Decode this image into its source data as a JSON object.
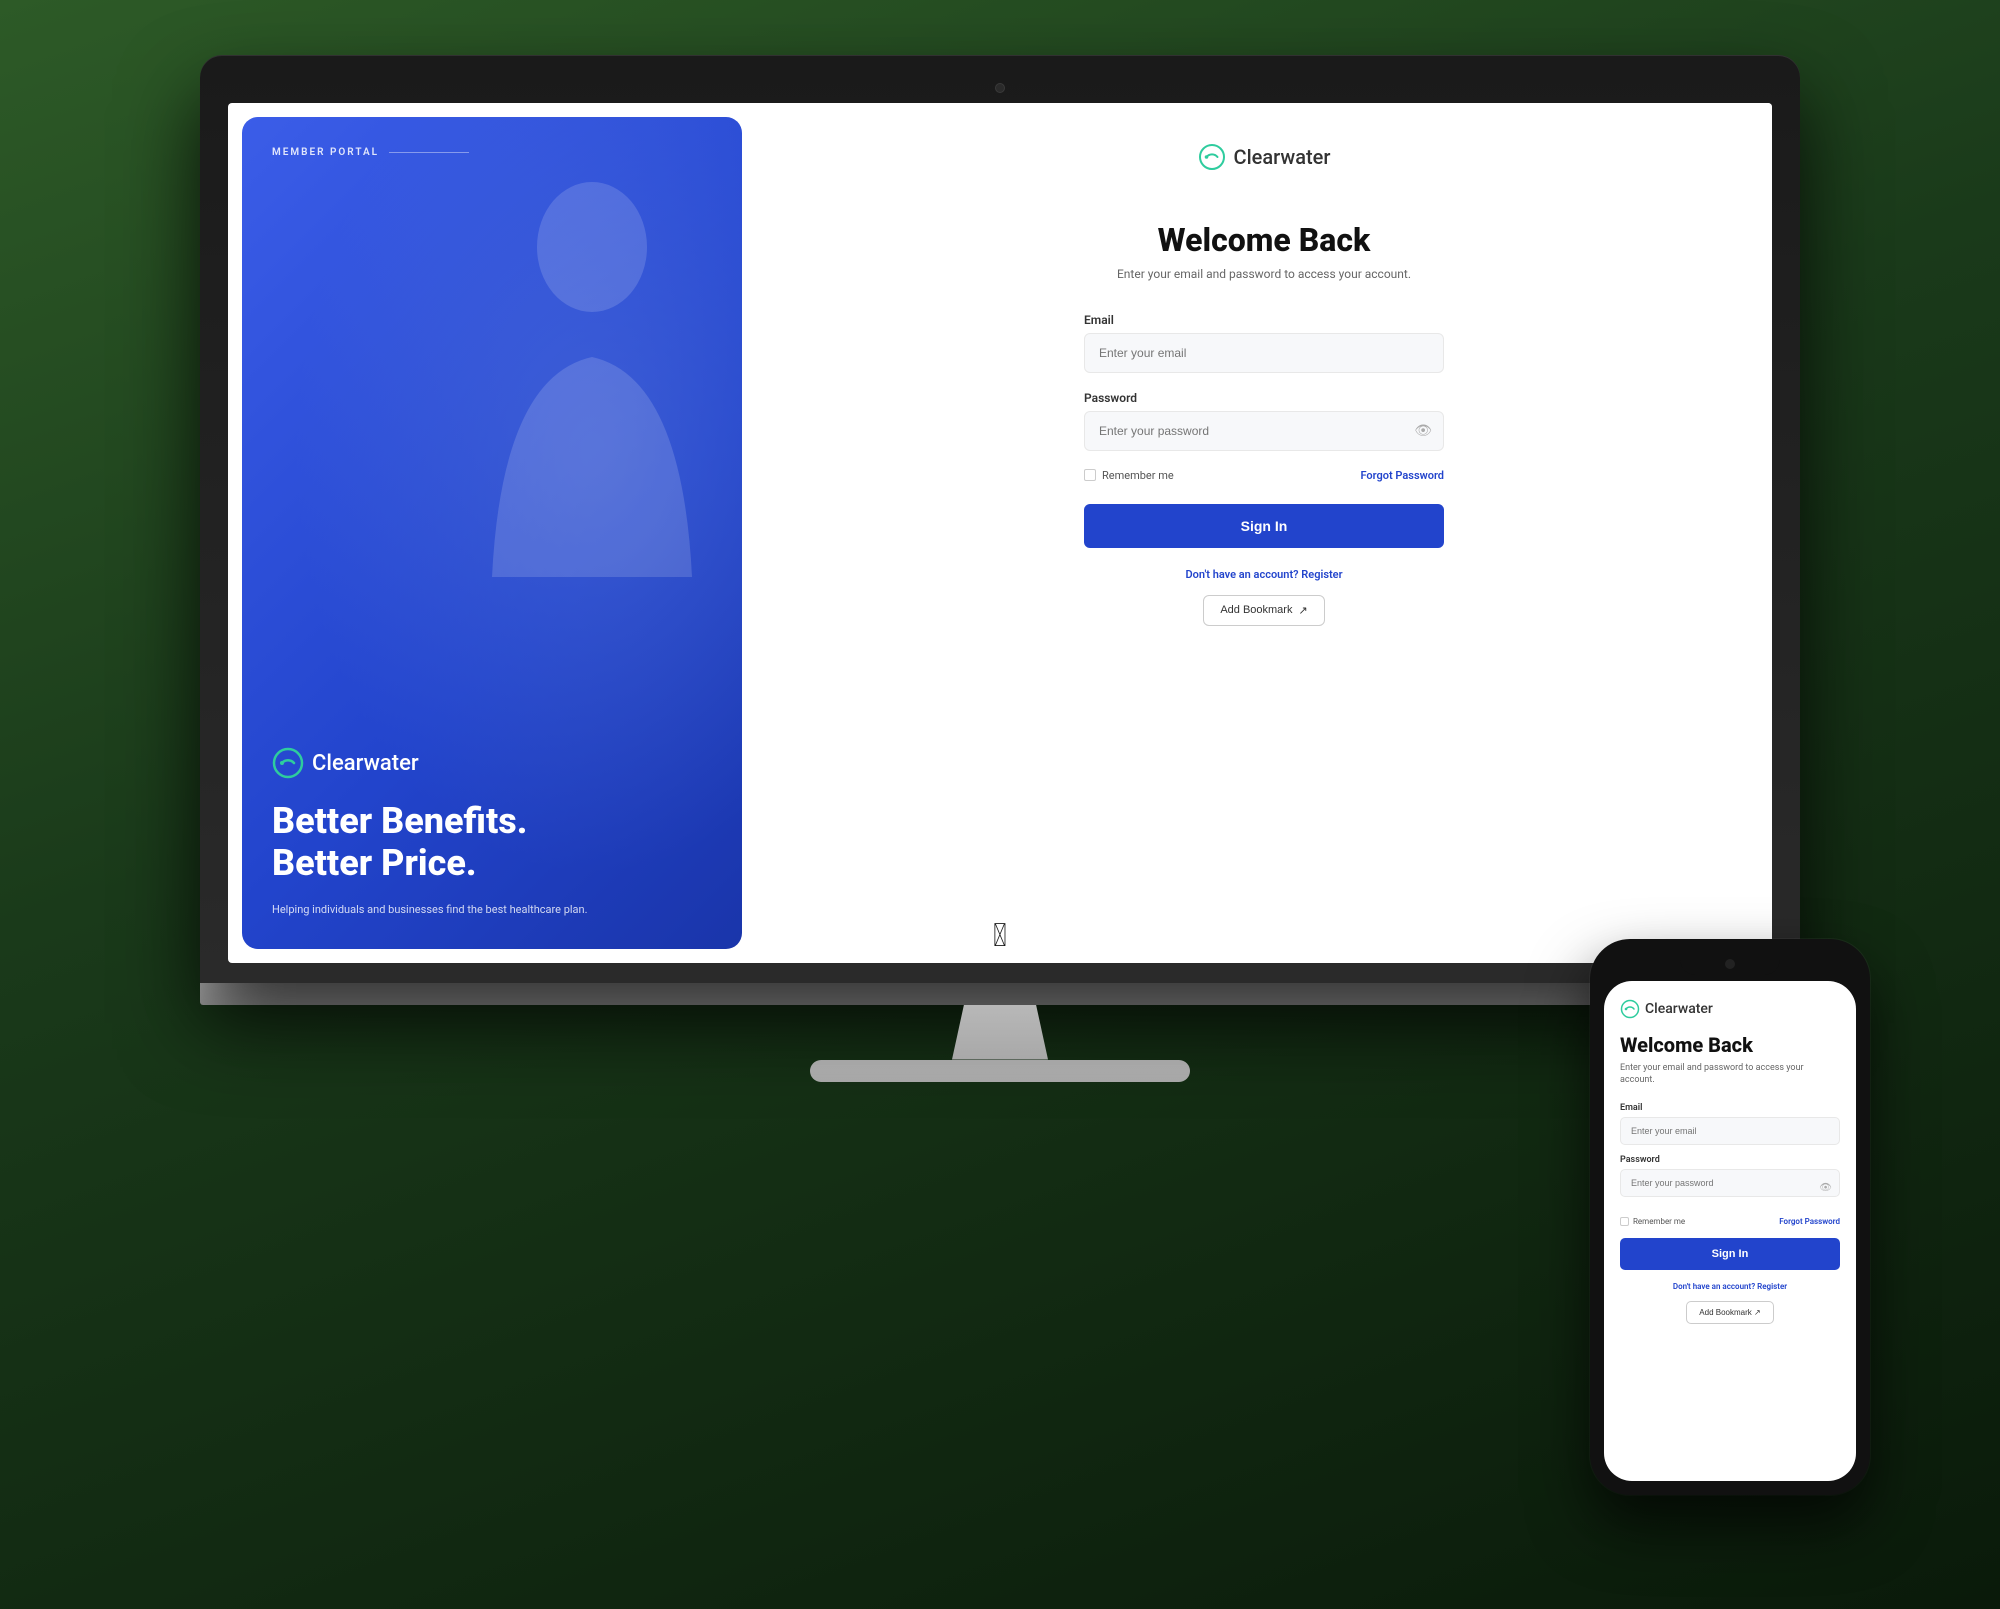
{
  "brand": {
    "name": "Clearwater",
    "color_primary": "#2ecc9e",
    "color_blue": "#2244cc"
  },
  "left_panel": {
    "member_portal_label": "MEMBER PORTAL",
    "tagline_line1": "Better Benefits.",
    "tagline_line2": "Better Price.",
    "description": "Helping individuals and businesses find the best healthcare plan."
  },
  "login_form": {
    "welcome_title": "Welcome Back",
    "welcome_subtitle": "Enter your email and password to access your account.",
    "email_label": "Email",
    "email_placeholder": "Enter your email",
    "password_label": "Password",
    "password_placeholder": "Enter your password",
    "remember_me_label": "Remember me",
    "forgot_password_label": "Forgot Password",
    "sign_in_label": "Sign In",
    "no_account_text": "Don't have an account?",
    "register_label": "Register",
    "add_bookmark_label": "Add Bookmark"
  },
  "mobile": {
    "welcome_title": "Welcome Back",
    "welcome_subtitle": "Enter your email and password to access your account.",
    "email_label": "Email",
    "email_placeholder": "Enter your email",
    "password_label": "Password",
    "password_placeholder": "Enter your password",
    "remember_me_label": "Remember me",
    "forgot_password_label": "Forgot Password",
    "sign_in_label": "Sign In",
    "no_account_text": "Don't have an account?",
    "register_label": "Register",
    "add_bookmark_label": "Add Bookmark ↗"
  }
}
